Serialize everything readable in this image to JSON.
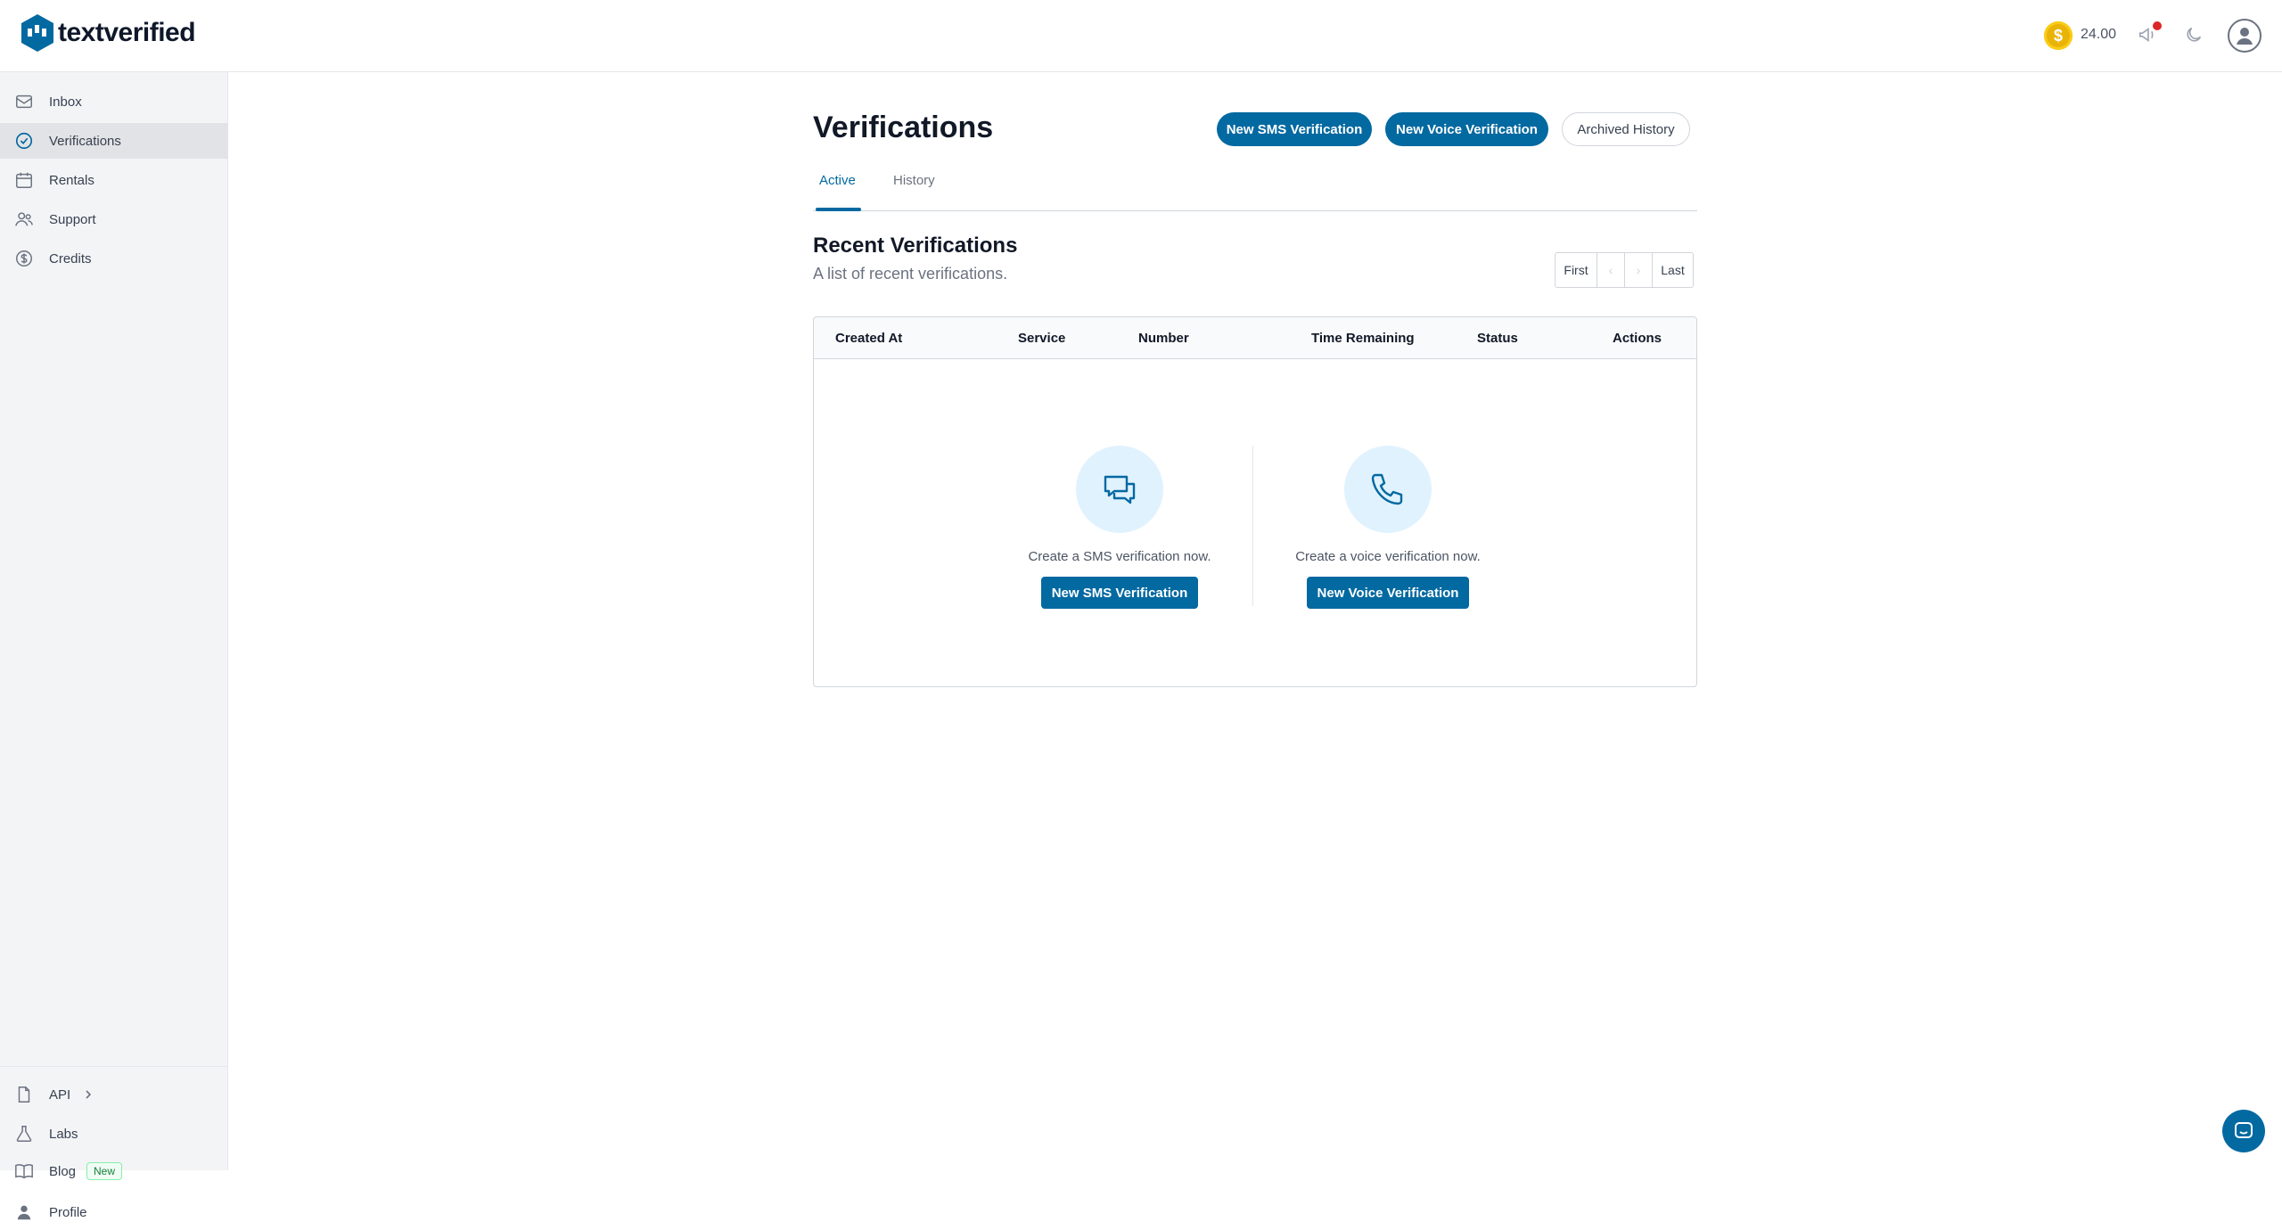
{
  "brand": {
    "name": "textverified",
    "accent": "#0369a1"
  },
  "header": {
    "credits": "24.00",
    "coin_symbol": "$"
  },
  "sidebar": {
    "items": [
      {
        "label": "Inbox",
        "icon": "inbox-icon"
      },
      {
        "label": "Verifications",
        "icon": "check-circle-icon",
        "active": true
      },
      {
        "label": "Rentals",
        "icon": "calendar-icon"
      },
      {
        "label": "Support",
        "icon": "users-icon"
      },
      {
        "label": "Credits",
        "icon": "dollar-circle-icon"
      }
    ],
    "bottom": [
      {
        "label": "API",
        "icon": "document-icon"
      },
      {
        "label": "Labs",
        "icon": "flask-icon"
      },
      {
        "label": "Blog",
        "icon": "book-icon",
        "badge": "New"
      },
      {
        "label": "Profile",
        "icon": "person-icon"
      }
    ]
  },
  "main": {
    "title": "Verifications",
    "actions": {
      "new_sms": "New SMS Verification",
      "new_voice": "New Voice Verification",
      "archived": "Archived History"
    },
    "tabs": [
      {
        "label": "Active"
      },
      {
        "label": "History"
      }
    ],
    "section_title": "Recent Verifications",
    "section_subtitle": "A list of recent verifications.",
    "pager": {
      "first": "First",
      "prev": "‹",
      "next": "›",
      "last": "Last"
    },
    "table": {
      "columns": [
        "Created At",
        "Service",
        "Number",
        "Time Remaining",
        "Status",
        "Actions"
      ]
    },
    "empty": {
      "sms_text": "Create a SMS verification now.",
      "sms_button": "New SMS Verification",
      "voice_text": "Create a voice verification now.",
      "voice_button": "New Voice Verification"
    }
  }
}
